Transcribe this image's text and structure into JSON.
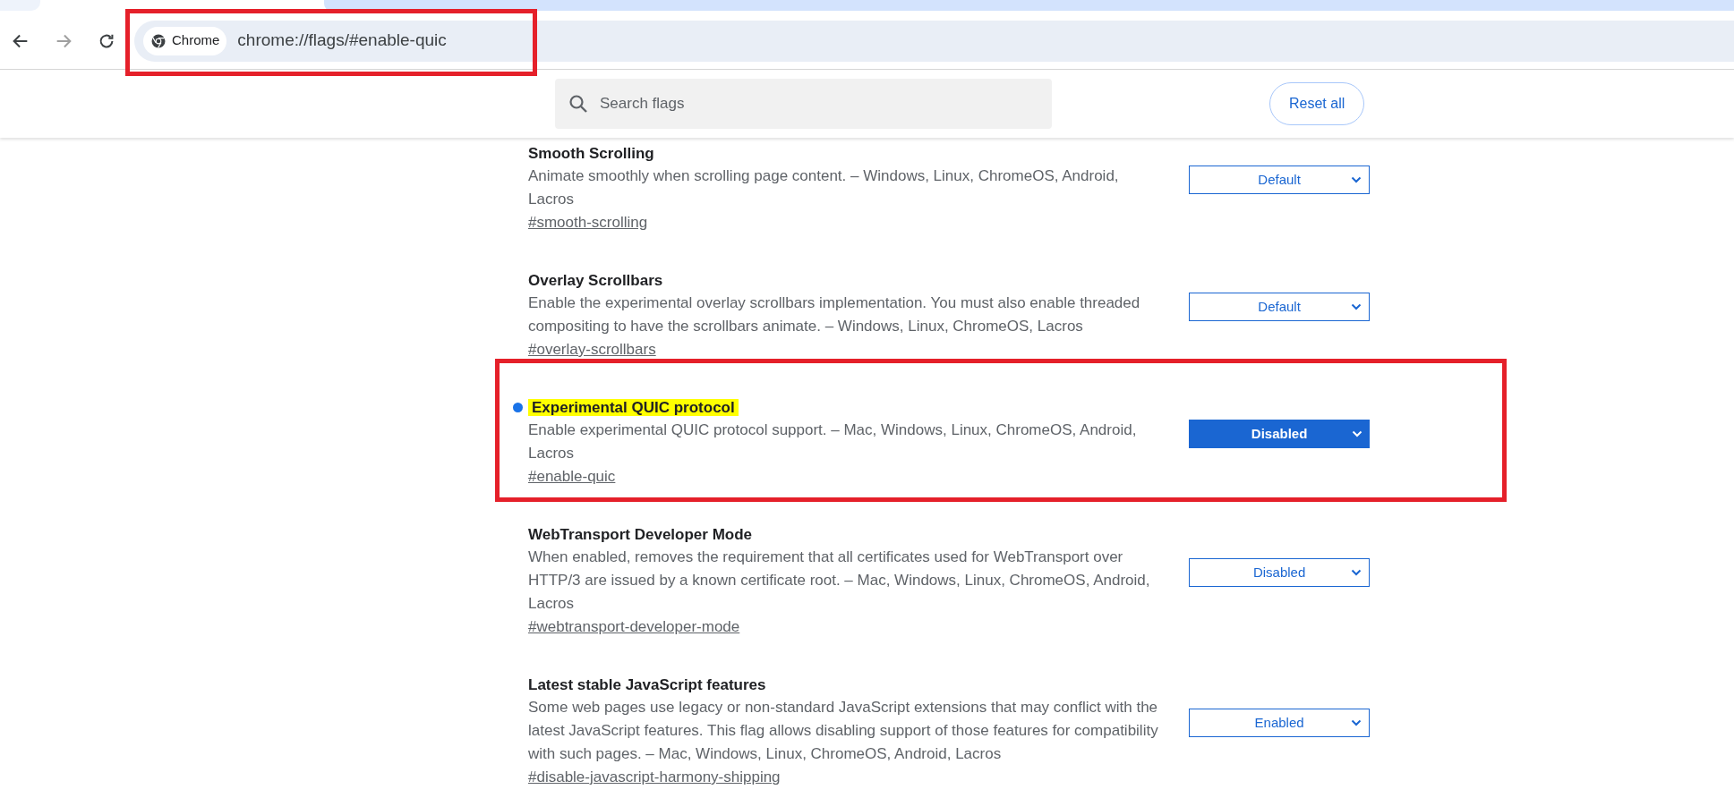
{
  "toolbar": {
    "forward_disabled": true
  },
  "address_bar": {
    "chip_label": "Chrome",
    "url": "chrome://flags/#enable-quic",
    "annotated": true
  },
  "search": {
    "placeholder": "Search flags"
  },
  "reset_button": "Reset all",
  "flags": [
    {
      "title": "Smooth Scrolling",
      "description": "Animate smoothly when scrolling page content. – Windows, Linux, ChromeOS, Android, Lacros",
      "link": "#smooth-scrolling",
      "value": "Default",
      "modified": false,
      "highlighted": false,
      "annotated": false
    },
    {
      "title": "Overlay Scrollbars",
      "description": "Enable the experimental overlay scrollbars implementation. You must also enable threaded compositing to have the scrollbars animate. – Windows, Linux, ChromeOS, Lacros",
      "link": "#overlay-scrollbars",
      "value": "Default",
      "modified": false,
      "highlighted": false,
      "annotated": false
    },
    {
      "title": "Experimental QUIC protocol",
      "description": "Enable experimental QUIC protocol support. – Mac, Windows, Linux, ChromeOS, Android, Lacros",
      "link": "#enable-quic",
      "value": "Disabled",
      "modified": true,
      "highlighted": true,
      "annotated": true
    },
    {
      "title": "WebTransport Developer Mode",
      "description": "When enabled, removes the requirement that all certificates used for WebTransport over HTTP/3 are issued by a known certificate root. – Mac, Windows, Linux, ChromeOS, Android, Lacros",
      "link": "#webtransport-developer-mode",
      "value": "Disabled",
      "modified": false,
      "highlighted": false,
      "annotated": false
    },
    {
      "title": "Latest stable JavaScript features",
      "description": "Some web pages use legacy or non-standard JavaScript extensions that may conflict with the latest JavaScript features. This flag allows disabling support of those features for compatibility with such pages. – Mac, Windows, Linux, ChromeOS, Android, Lacros",
      "link": "#disable-javascript-harmony-shipping",
      "value": "Enabled",
      "modified": false,
      "highlighted": false,
      "annotated": false
    }
  ]
}
